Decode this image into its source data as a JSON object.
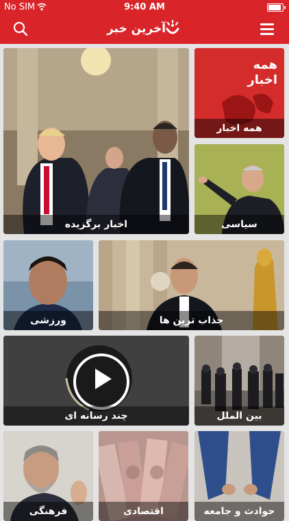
{
  "status": {
    "carrier": "No SIM",
    "time": "9:40 AM"
  },
  "navbar": {
    "logo_text": "آخرین خبر"
  },
  "tiles": [
    {
      "label": "اخبار برگزیده"
    },
    {
      "label": "همه اخبار",
      "poster": "همه\nاخبار"
    },
    {
      "label": "سیاسی"
    },
    {
      "label": "ورزشی"
    },
    {
      "label": "جذاب ترین ها"
    },
    {
      "label": "چند رسانه ای"
    },
    {
      "label": "بین الملل"
    },
    {
      "label": "فرهنگی"
    },
    {
      "label": "اقتصادی"
    },
    {
      "label": "حوادث و جامعه"
    }
  ],
  "colors": {
    "brand_red": "#d9252a",
    "background": "#e4e4e4"
  }
}
